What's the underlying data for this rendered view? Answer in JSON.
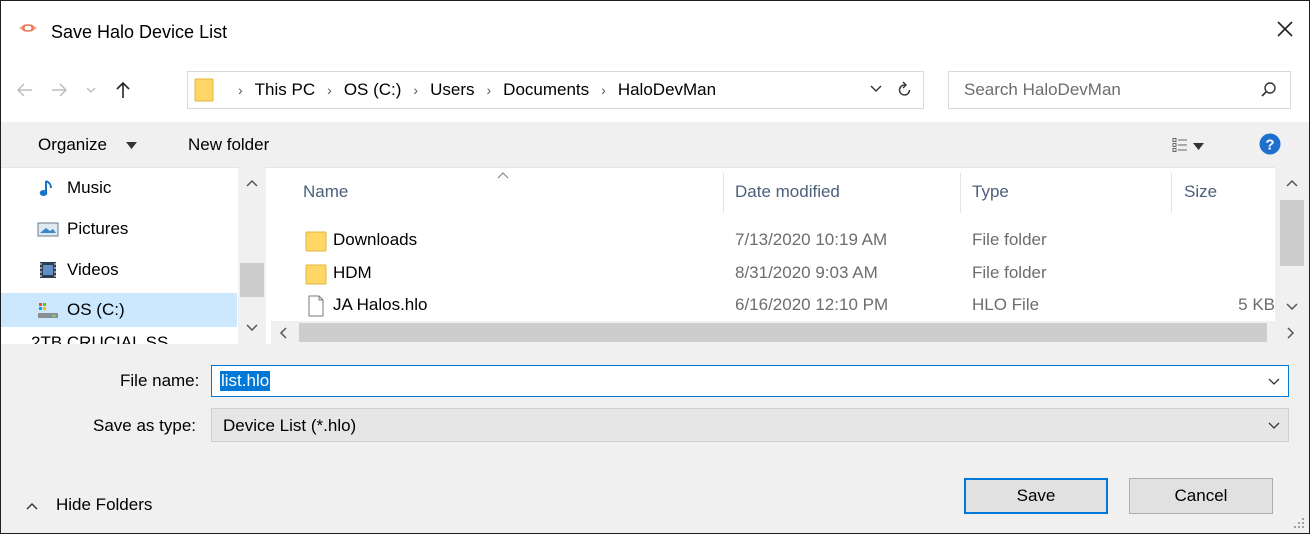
{
  "window": {
    "title": "Save Halo Device List"
  },
  "address": {
    "breadcrumbs": [
      "This PC",
      "OS (C:)",
      "Users",
      "Documents",
      "HaloDevMan"
    ]
  },
  "search": {
    "placeholder": "Search HaloDevMan"
  },
  "toolbar": {
    "organize_label": "Organize",
    "new_folder_label": "New folder"
  },
  "nav_pane": {
    "items": [
      {
        "label": "Music",
        "icon": "music-icon"
      },
      {
        "label": "Pictures",
        "icon": "pictures-icon"
      },
      {
        "label": "Videos",
        "icon": "videos-icon"
      },
      {
        "label": "OS (C:)",
        "icon": "drive-icon",
        "selected": true
      }
    ],
    "partial_item": "2TB CRUCIAL SS"
  },
  "file_list": {
    "columns": [
      "Name",
      "Date modified",
      "Type",
      "Size"
    ],
    "rows": [
      {
        "name": "Downloads",
        "date": "7/13/2020 10:19 AM",
        "type": "File folder",
        "size": "",
        "icon": "folder-icon"
      },
      {
        "name": "HDM",
        "date": "8/31/2020 9:03 AM",
        "type": "File folder",
        "size": "",
        "icon": "folder-icon"
      },
      {
        "name": "JA Halos.hlo",
        "date": "6/16/2020 12:10 PM",
        "type": "HLO File",
        "size": "5 KB",
        "icon": "file-icon"
      }
    ]
  },
  "form": {
    "file_name_label": "File name:",
    "file_name_value": "list.hlo",
    "save_type_label": "Save as type:",
    "save_type_value": "Device List (*.hlo)"
  },
  "footer": {
    "hide_folders_label": "Hide Folders",
    "save_label": "Save",
    "cancel_label": "Cancel"
  },
  "colors": {
    "accent": "#0078d7",
    "selection": "#cce8ff",
    "folder": "#ffd766"
  }
}
